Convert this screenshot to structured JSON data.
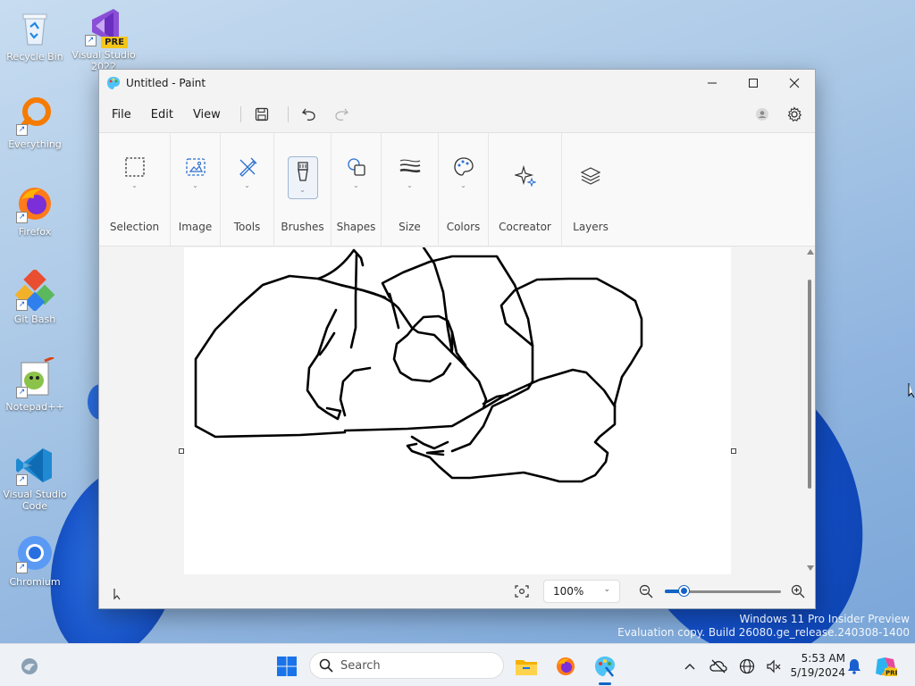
{
  "desktop": {
    "icons": [
      {
        "label": "Recycle Bin",
        "icon": "recycle-bin-icon"
      },
      {
        "label": "Visual Studio 2022",
        "icon": "visual-studio-icon",
        "badge": "PRE"
      },
      {
        "label": "Everything",
        "icon": "everything-search-icon"
      },
      {
        "label": "Firefox",
        "icon": "firefox-icon"
      },
      {
        "label": "Git Bash",
        "icon": "git-bash-icon"
      },
      {
        "label": "Notepad++",
        "icon": "notepad-plus-plus-icon"
      },
      {
        "label": "Visual Studio Code",
        "icon": "vscode-icon"
      },
      {
        "label": "Chromium",
        "icon": "chromium-icon"
      }
    ]
  },
  "window": {
    "title": "Untitled - Paint",
    "controls": {
      "minimize": "minimize-icon",
      "maximize": "maximize-icon",
      "close": "close-icon"
    }
  },
  "menubar": {
    "items": [
      {
        "label": "File"
      },
      {
        "label": "Edit"
      },
      {
        "label": "View"
      }
    ],
    "quick_actions": [
      "save-icon",
      "undo-icon",
      "redo-icon"
    ]
  },
  "toolbar": {
    "groups": [
      {
        "label": "Selection",
        "icon": "selection-icon",
        "dropdown": true
      },
      {
        "label": "Image",
        "icon": "image-icon",
        "dropdown": true
      },
      {
        "label": "Tools",
        "icon": "tools-icon",
        "dropdown": true
      },
      {
        "label": "Brushes",
        "icon": "brush-icon",
        "dropdown": true,
        "active": true
      },
      {
        "label": "Shapes",
        "icon": "shapes-icon",
        "dropdown": true
      },
      {
        "label": "Size",
        "icon": "size-icon",
        "dropdown": true
      },
      {
        "label": "Colors",
        "icon": "palette-icon",
        "dropdown": true
      },
      {
        "label": "Cocreator",
        "icon": "cocreator-sparkle-icon",
        "dropdown": false
      },
      {
        "label": "Layers",
        "icon": "layers-icon",
        "dropdown": false
      }
    ]
  },
  "statusbar": {
    "zoom_label": "100%",
    "zoom_percent": 100,
    "zoom_slider_fraction": 0.17
  },
  "watermark": {
    "line1": "Windows 11 Pro Insider Preview",
    "line2": "Evaluation copy. Build 26080.ge_release.240308-1400"
  },
  "taskbar": {
    "search_placeholder": "Search",
    "time": "5:53 AM",
    "date": "5/19/2024"
  },
  "colors": {
    "accent": "#1463c6",
    "stroke": "#000000"
  }
}
